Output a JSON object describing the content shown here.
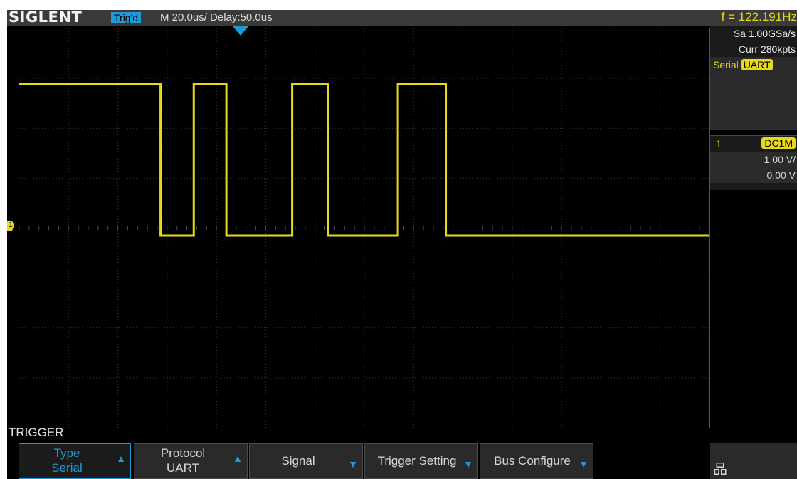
{
  "topbar": {
    "brand": "SIGLENT",
    "trigger_status": "Trig'd",
    "timebase": "M 20.0us/  Delay:50.0us",
    "frequency": "f = 122.191Hz"
  },
  "acquisition": {
    "sample_rate": "Sa 1.00GSa/s",
    "memory_depth": "Curr 280kpts"
  },
  "trigger_source": {
    "label": "Serial",
    "protocol_badge": "UART"
  },
  "channel1": {
    "number": "1",
    "coupling": "DC1M",
    "scale": "1.00 V/",
    "offset": "0.00 V",
    "marker": "1",
    "color": "#e8d81a"
  },
  "waveform": {
    "high_level": 1,
    "low_level": 0,
    "levels_x_us": [
      [
        0,
        1
      ],
      [
        46.8,
        0
      ],
      [
        57.8,
        1
      ],
      [
        68.6,
        0
      ],
      [
        90.4,
        1
      ],
      [
        102.2,
        0
      ],
      [
        125.4,
        1
      ],
      [
        141.3,
        0
      ],
      [
        228.6,
        0
      ]
    ]
  },
  "menu": {
    "title": "TRIGGER",
    "softkeys": [
      {
        "name": "type",
        "line1": "Type",
        "line2": "Serial",
        "arrow": "up"
      },
      {
        "name": "protocol",
        "line1": "Protocol",
        "line2": "UART",
        "arrow": "up"
      },
      {
        "name": "signal",
        "label": "Signal",
        "arrow": "down"
      },
      {
        "name": "trigger-setting",
        "label": "Trigger Setting",
        "arrow": "down"
      },
      {
        "name": "bus-configure",
        "label": "Bus Configure",
        "arrow": "down"
      }
    ],
    "network_icon": "network-icon"
  },
  "colors": {
    "accent": "#1e9ad6",
    "trace": "#e8d81a"
  }
}
